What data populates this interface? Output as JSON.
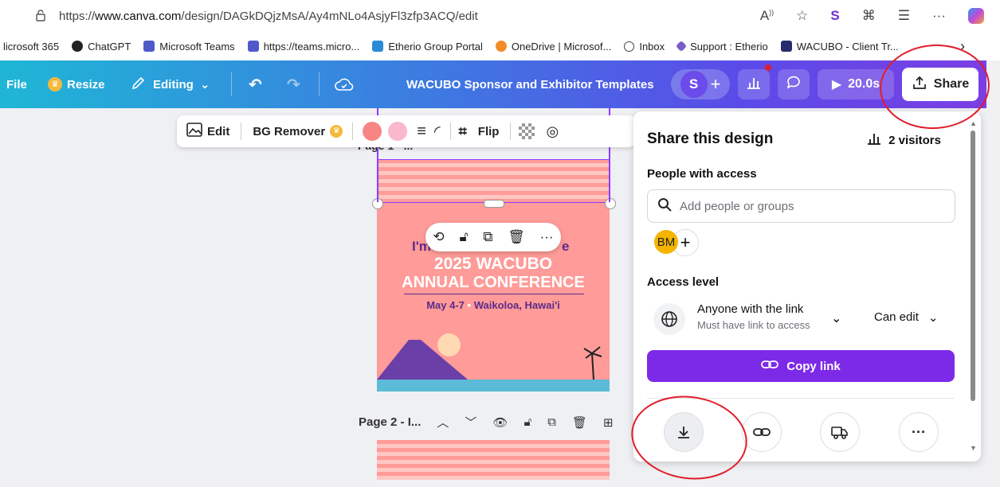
{
  "browser": {
    "url_prefix": "https://",
    "url_domain": "www.canva.com",
    "url_path": "/design/DAGkDQjzMsA/Ay4mNLo4AsjyFl3zfp3ACQ/edit",
    "icons": [
      "read-aloud-icon",
      "favorite-star-icon",
      "extension-icon",
      "puzzle-icon",
      "favorites-list-icon",
      "more-icon",
      "copilot-icon"
    ]
  },
  "bookmarks": [
    {
      "label": "licrosoft 365",
      "color": "#ffffff"
    },
    {
      "label": "ChatGPT",
      "color": "#222222"
    },
    {
      "label": "Microsoft Teams",
      "color": "#5059c9"
    },
    {
      "label": "https://teams.micro...",
      "color": "#5059c9"
    },
    {
      "label": "Etherio Group Portal",
      "color": "#2b8ad8"
    },
    {
      "label": "OneDrive | Microsof...",
      "color": "#f28c28"
    },
    {
      "label": "Inbox",
      "color": "#444444"
    },
    {
      "label": "Support : Etherio",
      "color": "#7a5cc8"
    },
    {
      "label": "WACUBO - Client Tr...",
      "color": "#2a2a6e"
    }
  ],
  "toolbar": {
    "file": "File",
    "resize": "Resize",
    "editing": "Editing",
    "title": "WACUBO Sponsor and Exhibitor Templates",
    "avatar": "S",
    "timer": "20.0s",
    "share": "Share"
  },
  "edit_tools": {
    "edit": "Edit",
    "bg_remover": "BG Remover",
    "flip": "Flip"
  },
  "design": {
    "page1_label": "Page 1 - ...",
    "line1": "I'm",
    "line1b": "e",
    "line2": "2025 WACUBO",
    "line3": "ANNUAL CONFERENCE",
    "line4a": "May 4-7",
    "line4b": "Waikoloa, Hawai'i",
    "page2_label": "Page 2 - I..."
  },
  "share_panel": {
    "title": "Share this design",
    "visitors": "2 visitors",
    "people_label": "People with access",
    "search_placeholder": "Add people or groups",
    "avatar_initials": "BM",
    "access_label": "Access level",
    "access_main": "Anyone with the link",
    "access_sub": "Must have link to access",
    "permission": "Can edit",
    "copy_link": "Copy link"
  },
  "colors": {
    "accent_purple": "#7d2ae8",
    "design_pink": "#ff9090",
    "annotation_red": "#e01d2a"
  }
}
